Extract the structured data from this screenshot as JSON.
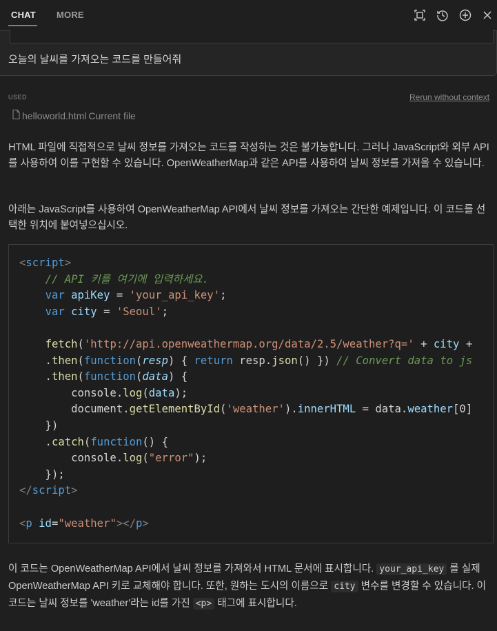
{
  "header": {
    "tabs": [
      {
        "label": "CHAT",
        "active": true
      },
      {
        "label": "MORE",
        "active": false
      }
    ],
    "icons": [
      "maximize-icon",
      "history-icon",
      "add-icon",
      "close-icon"
    ]
  },
  "prompt": {
    "text": "오늘의 날씨를 가져오는 코드를 만들어줘"
  },
  "context": {
    "used_label": "USED",
    "rerun_label": "Rerun without context",
    "file_name": "helloworld.html",
    "file_note": "Current file"
  },
  "answer": {
    "para1": "HTML 파일에 직접적으로 날씨 정보를 가져오는 코드를 작성하는 것은 불가능합니다. 그러나 JavaScript와 외부 API를 사용하여 이를 구현할 수 있습니다. OpenWeatherMap과 같은 API를 사용하여 날씨 정보를 가져올 수 있습니다.",
    "para2": "아래는 JavaScript를 사용하여 OpenWeatherMap API에서 날씨 정보를 가져오는 간단한 예제입니다. 이 코드를 선택한 위치에 붙여넣으십시오.",
    "para3_a": "이 코드는 OpenWeatherMap API에서 날씨 정보를 가져와서 HTML 문서에 표시합니다.",
    "para3_code1": "your_api_key",
    "para3_b": "를 실제 OpenWeatherMap API 키로 교체해야 합니다. 또한, 원하는 도시의 이름으로",
    "para3_code2": "city",
    "para3_c": "변수를 변경할 수 있습니다. 이 코드는 날씨 정보를 'weather'라는 id를 가진",
    "para3_code3": "<p>",
    "para3_d": "태그에 표시합니다."
  },
  "code": {
    "comment": "// API 키를 여기에 입력하세요.",
    "api_key": "'your_api_key'",
    "city": "'Seoul'",
    "url": "'http://api.openweathermap.org/data/2.5/weather?q='",
    "convert_comment": "// Convert data to js",
    "element_id": "'weather'",
    "error_str": "\"error\"",
    "p_id": "\"weather\""
  }
}
